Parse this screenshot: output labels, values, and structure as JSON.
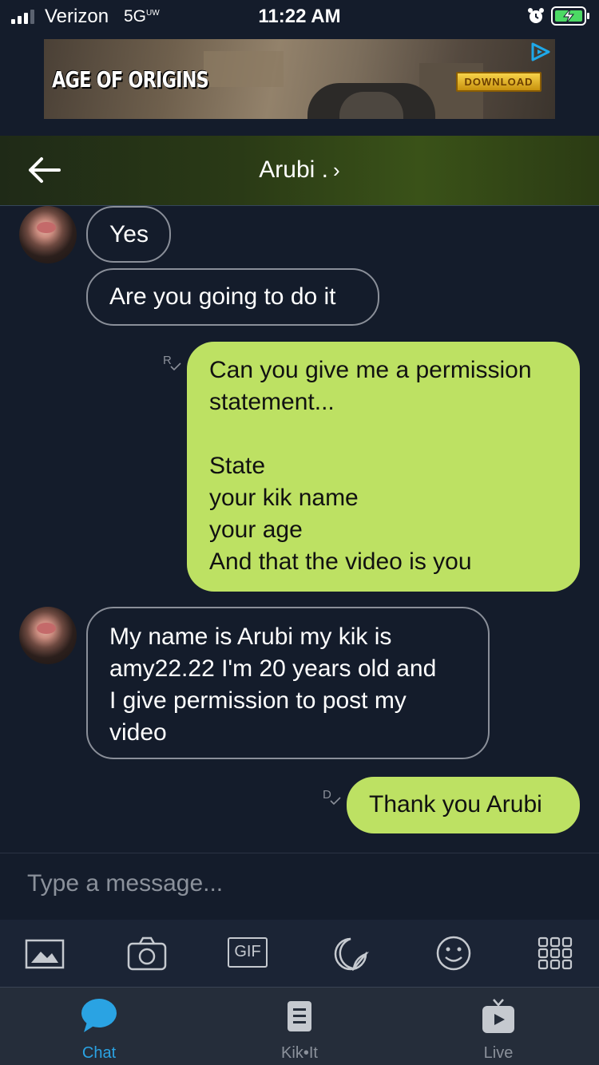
{
  "status_bar": {
    "carrier": "Verizon",
    "network": "5G",
    "network_suffix": "UW",
    "time": "11:22 AM"
  },
  "ad": {
    "title": "AGE OF ORIGINS",
    "cta": "DOWNLOAD",
    "choices_icon": "adchoices-icon"
  },
  "header": {
    "back_icon": "back-arrow-icon",
    "title": "Arubi .",
    "chevron": "›"
  },
  "messages": [
    {
      "from": "them",
      "text": "Yes"
    },
    {
      "from": "them",
      "text": "Are you going to do it"
    },
    {
      "from": "me",
      "receipt": "R",
      "lines": [
        "Can you give me a permission",
        "statement...",
        "",
        "State",
        "your kik name",
        "your age",
        "And that the video is you"
      ]
    },
    {
      "from": "them",
      "lines": [
        "My name is Arubi my kik is",
        "amy22.22 I'm 20 years old and",
        "I give permission to post my",
        "video"
      ]
    },
    {
      "from": "me",
      "receipt": "D",
      "text": "Thank you Arubi"
    }
  ],
  "composer": {
    "placeholder": "Type a message..."
  },
  "toolbar": {
    "items": [
      "gallery-icon",
      "camera-icon",
      "gif-icon",
      "sticker-icon",
      "smiley-icon",
      "more-apps-icon"
    ],
    "gif_label": "GIF"
  },
  "bottom_nav": {
    "items": [
      {
        "label": "Chat",
        "icon": "chat-bubble-icon",
        "active": true
      },
      {
        "label": "Kik•It",
        "icon": "kikit-icon",
        "active": false
      },
      {
        "label": "Live",
        "icon": "live-tv-icon",
        "active": false
      }
    ]
  },
  "colors": {
    "background": "#141c2b",
    "outgoing_bubble": "#bde163",
    "active_tab": "#2aa3e3"
  }
}
